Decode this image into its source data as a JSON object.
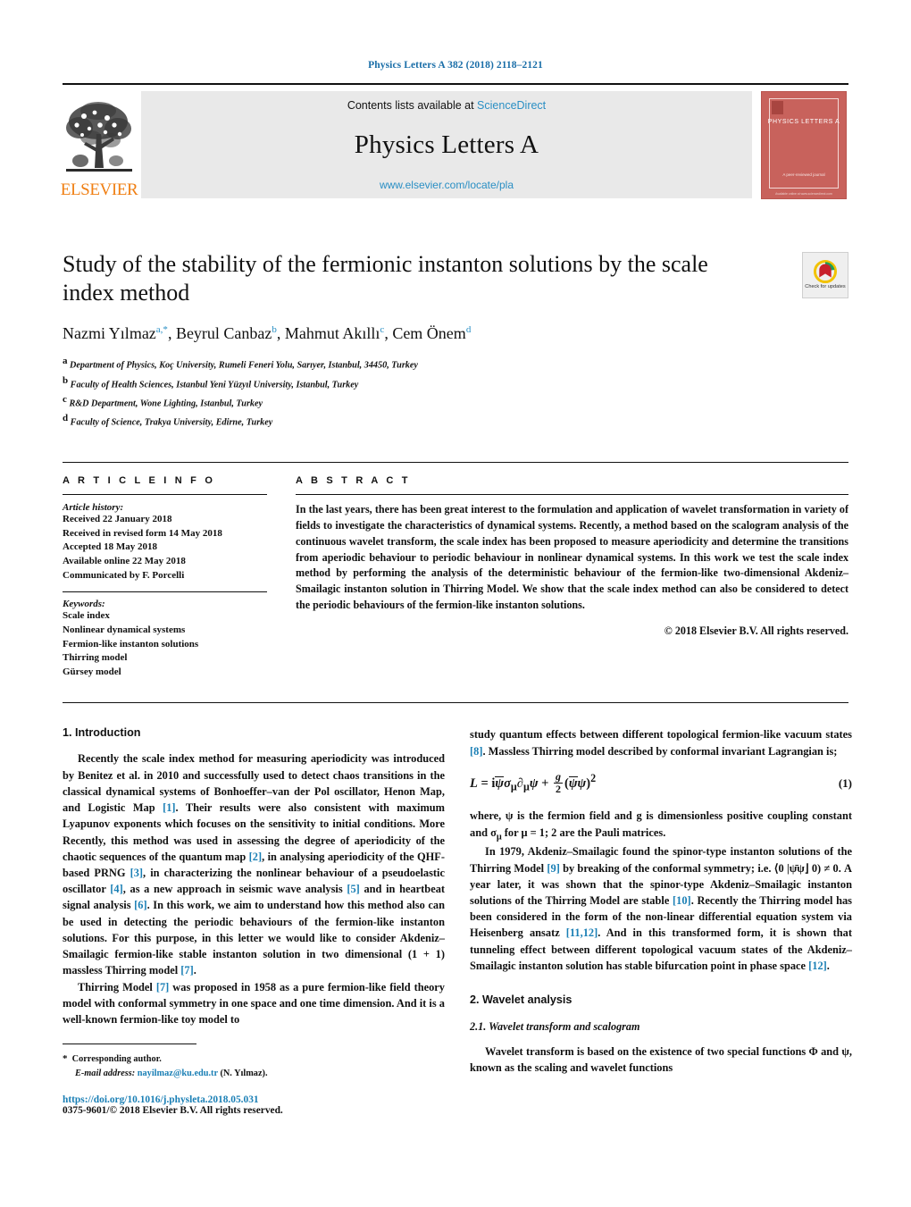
{
  "running_head": "Physics Letters A 382 (2018) 2118–2121",
  "masthead": {
    "contents_prefix": "Contents lists available at ",
    "sciencedirect": "ScienceDirect",
    "journal_title": "Physics Letters A",
    "journal_url": "www.elsevier.com/locate/pla",
    "publisher_logo_text": "ELSEVIER",
    "cover": {
      "title": "PHYSICS LETTERS A",
      "footer": "A peer-reviewed journal",
      "bottom": "Available online at www.sciencedirect.com"
    },
    "accent_link_color": "#2a8fc4",
    "elsevier_orange": "#f07f13",
    "cover_red": "#c8625c"
  },
  "article": {
    "title": "Study of the stability of the fermionic instanton solutions by the scale index method",
    "authors": [
      {
        "name": "Nazmi Yılmaz",
        "marks": "a,*"
      },
      {
        "name": "Beyrul Canbaz",
        "marks": "b"
      },
      {
        "name": "Mahmut Akıllı",
        "marks": "c"
      },
      {
        "name": "Cem Önem",
        "marks": "d"
      }
    ],
    "affiliations": [
      {
        "mark": "a",
        "text": "Department of Physics, Koç University, Rumeli Feneri Yolu, Sarıyer, Istanbul, 34450, Turkey"
      },
      {
        "mark": "b",
        "text": "Faculty of Health Sciences, Istanbul Yeni Yüzyıl University, Istanbul, Turkey"
      },
      {
        "mark": "c",
        "text": "R&D Department, Wone Lighting, Istanbul, Turkey"
      },
      {
        "mark": "d",
        "text": "Faculty of Science, Trakya University, Edirne, Turkey"
      }
    ],
    "crossmark_label": "Check for updates"
  },
  "info": {
    "heading": "A R T I C L E   I N F O",
    "history_title": "Article history:",
    "history": [
      "Received 22 January 2018",
      "Received in revised form 14 May 2018",
      "Accepted 18 May 2018",
      "Available online 22 May 2018",
      "Communicated by F. Porcelli"
    ],
    "keywords_title": "Keywords:",
    "keywords": [
      "Scale index",
      "Nonlinear dynamical systems",
      "Fermion-like instanton solutions",
      "Thirring model",
      "Gürsey model"
    ]
  },
  "abstract": {
    "heading": "A B S T R A C T",
    "text": "In the last years, there has been great interest to the formulation and application of wavelet transformation in variety of fields to investigate the characteristics of dynamical systems. Recently, a method based on the scalogram analysis of the continuous wavelet transform, the scale index has been proposed to measure aperiodicity and determine the transitions from aperiodic behaviour to periodic behaviour in nonlinear dynamical systems. In this work we test the scale index method by performing the analysis of the deterministic behaviour of the fermion-like two-dimensional Akdeniz–Smailagic instanton solution in Thirring Model. We show that the scale index method can also be considered to detect the periodic behaviours of the fermion-like instanton solutions.",
    "copyright": "© 2018 Elsevier B.V. All rights reserved."
  },
  "body": {
    "intro_heading": "1.  Introduction",
    "left_p1_a": "Recently the scale index method for measuring aperiodicity was introduced by Benitez et al. in 2010 and successfully used to detect chaos transitions in the classical dynamical systems of Bonhoeffer–van der Pol oscillator, Henon Map, and Logistic Map ",
    "left_p1_r1": "[1]",
    "left_p1_b": ". Their results were also consistent with maximum Lyapunov exponents which focuses on the sensitivity to initial conditions. More Recently, this method was used in assessing the degree of aperiodicity of the chaotic sequences of the quantum map ",
    "left_p1_r2": "[2]",
    "left_p1_c": ", in analysing aperiodicity of the QHF-based PRNG ",
    "left_p1_r3": "[3]",
    "left_p1_d": ", in characterizing the nonlinear behaviour of a pseudoelastic oscillator ",
    "left_p1_r4": "[4]",
    "left_p1_e": ", as a new approach in seismic wave analysis ",
    "left_p1_r5": "[5]",
    "left_p1_f": " and in heartbeat signal analysis ",
    "left_p1_r6": "[6]",
    "left_p1_g": ". In this work, we aim to understand how this method also can be used in detecting the periodic behaviours of the fermion-like instanton solutions. For this purpose, in this letter we would like to consider Akdeniz–Smailagic fermion-like stable instanton solution in two dimensional (1 + 1) massless Thirring model ",
    "left_p1_r7": "[7]",
    "left_p1_h": ".",
    "left_p2_a": "Thirring Model ",
    "left_p2_r1": "[7]",
    "left_p2_b": " was proposed in 1958 as a pure fermion-like field theory model with conformal symmetry in one space and one time dimension. And it is a well-known fermion-like toy model to",
    "right_p1_a": "study quantum effects between different topological fermion-like vacuum states ",
    "right_p1_r1": "[8]",
    "right_p1_b": ". Massless Thirring model described by conformal invariant Lagrangian is;",
    "equation_number": "(1)",
    "right_p2_a": "where, ψ is the fermion field and g is dimensionless positive coupling constant and σ",
    "right_p2_b": " for μ = 1; 2 are the Pauli matrices.",
    "right_p3_a": "In 1979, Akdeniz–Smailagic found the spinor-type instanton solutions of the Thirring Model ",
    "right_p3_r1": "[9]",
    "right_p3_b": " by breaking of the conformal symmetry; i.e. ⟨0 |ψ̄ψ⌋ 0) ≠ 0. A year later, it was shown that the spinor-type Akdeniz–Smailagic instanton solutions of the Thirring Model are stable ",
    "right_p3_r2": "[10]",
    "right_p3_c": ". Recently the Thirring model has been considered in the form of the non-linear differential equation system via Heisenberg ansatz ",
    "right_p3_r3": "[11,12]",
    "right_p3_d": ". And in this transformed form, it is shown that tunneling effect between different topological vacuum states of the Akdeniz–Smailagic instanton solution has stable bifurcation point in phase space ",
    "right_p3_r4": "[12]",
    "right_p3_e": ".",
    "wavelet_heading": "2.  Wavelet analysis",
    "wavelet_sub": "2.1.  Wavelet transform and scalogram",
    "right_p4": "Wavelet transform is based on the existence of two special functions Φ and ψ, known as the scaling and wavelet functions"
  },
  "footnote": {
    "star": "*",
    "corresponding": "Corresponding author.",
    "email_label": "E-mail address:",
    "email": "nayilmaz@ku.edu.tr",
    "email_owner": "(N. Yılmaz).",
    "doi": "https://doi.org/10.1016/j.physleta.2018.05.031",
    "issn": "0375-9601/© 2018 Elsevier B.V. All rights reserved."
  }
}
